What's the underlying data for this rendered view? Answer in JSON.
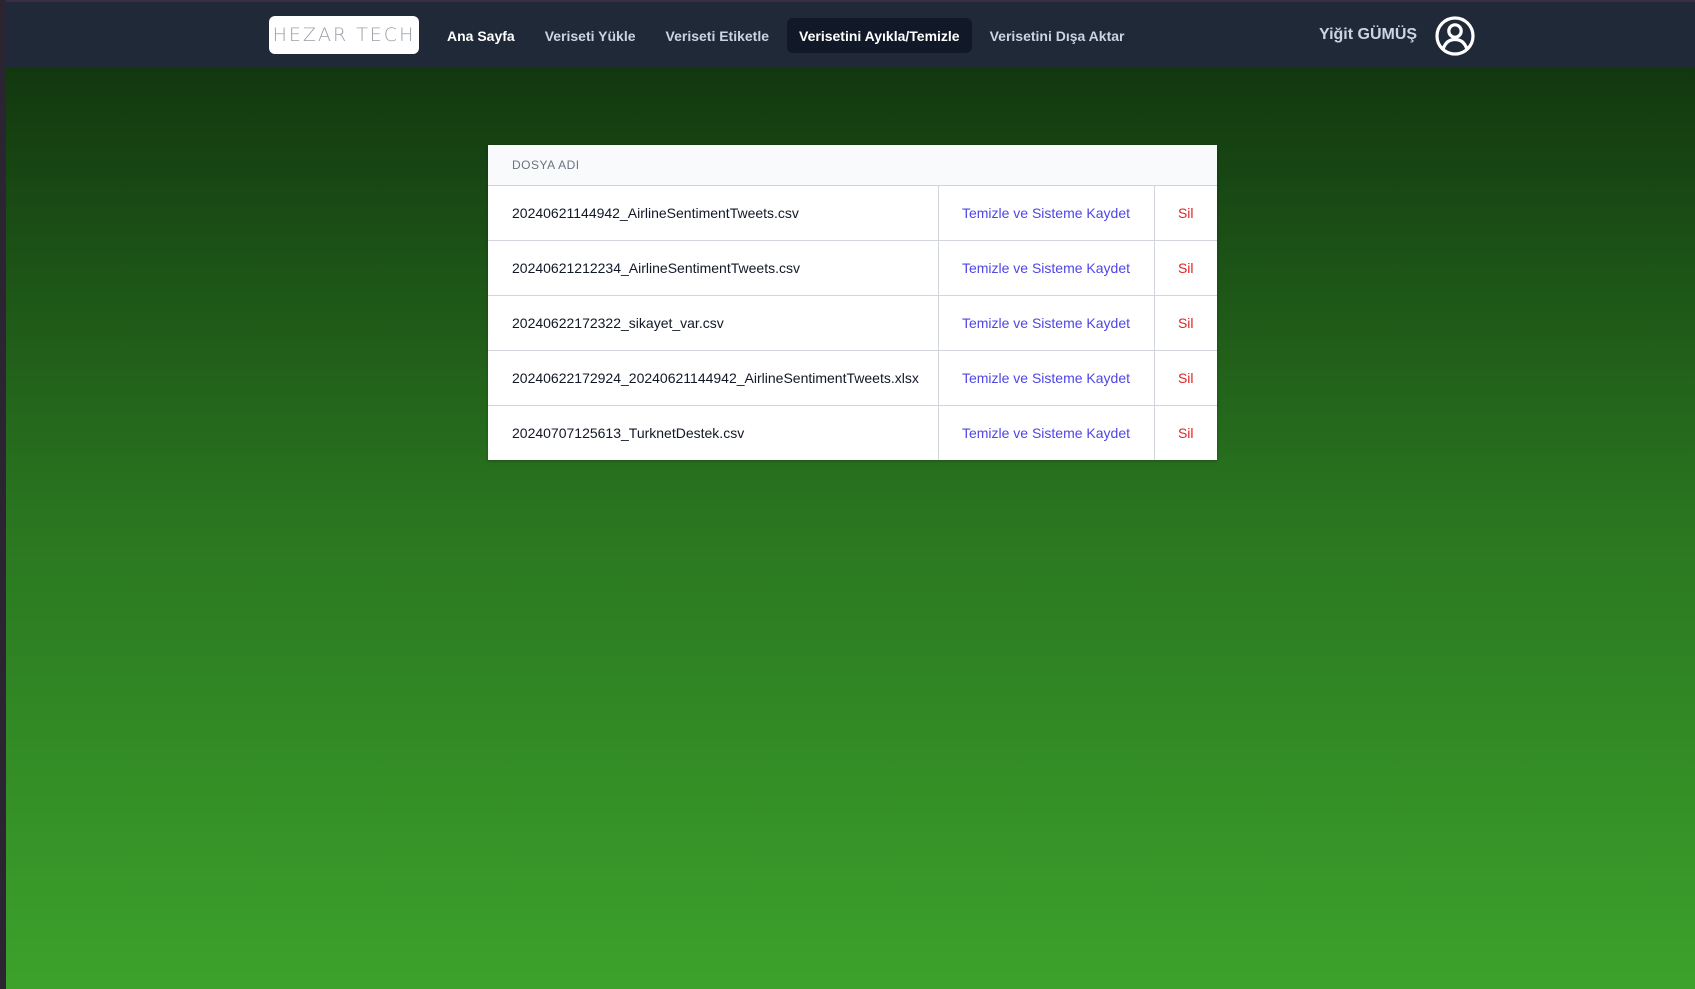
{
  "header": {
    "logo_text": "HEZAR TECH",
    "nav": [
      {
        "label": "Ana Sayfa"
      },
      {
        "label": "Veriseti Yükle"
      },
      {
        "label": "Veriseti Etiketle"
      },
      {
        "label": "Verisetini Ayıkla/Temizle"
      },
      {
        "label": "Verisetini Dışa Aktar"
      }
    ],
    "active_nav": "Verisetini Ayıkla/Temizle",
    "user_name": "Yiğit GÜMÜŞ",
    "user_icon": "user-circle-icon"
  },
  "table": {
    "column_header": "DOSYA ADI",
    "rows": [
      {
        "filename": "20240621144942_AirlineSentimentTweets.csv",
        "action_label": "Temizle ve Sisteme Kaydet",
        "delete_label": "Sil"
      },
      {
        "filename": "20240621212234_AirlineSentimentTweets.csv",
        "action_label": "Temizle ve Sisteme Kaydet",
        "delete_label": "Sil"
      },
      {
        "filename": "20240622172322_sikayet_var.csv",
        "action_label": "Temizle ve Sisteme Kaydet",
        "delete_label": "Sil"
      },
      {
        "filename": "20240622172924_20240621144942_AirlineSentimentTweets.xlsx",
        "action_label": "Temizle ve Sisteme Kaydet",
        "delete_label": "Sil"
      },
      {
        "filename": "20240707125613_TurknetDestek.csv",
        "action_label": "Temizle ve Sisteme Kaydet",
        "delete_label": "Sil"
      }
    ]
  },
  "colors": {
    "header_bg": "#1f2937",
    "active_nav_bg": "#111827",
    "link_primary": "#4f46e5",
    "link_danger": "#dc2626",
    "background_top": "#0d2c0c",
    "background_bottom": "#3ca22b"
  }
}
